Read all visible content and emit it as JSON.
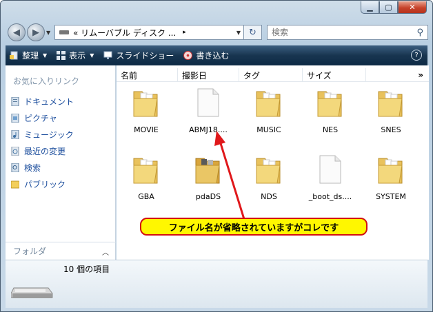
{
  "window": {
    "caption_buttons": [
      "minimize",
      "maximize",
      "close"
    ]
  },
  "address_bar": {
    "path_text": "« リムーバブル ディスク ...",
    "path_arrow": "▸"
  },
  "search": {
    "placeholder": "検索"
  },
  "toolbar": {
    "organize": "整理",
    "views": "表示",
    "slideshow": "スライドショー",
    "burn": "書き込む"
  },
  "favorites": {
    "title": "お気に入りリンク",
    "items": [
      {
        "label": "ドキュメント",
        "icon": "documents-icon"
      },
      {
        "label": "ピクチャ",
        "icon": "pictures-icon"
      },
      {
        "label": "ミュージック",
        "icon": "music-icon"
      },
      {
        "label": "最近の変更",
        "icon": "recent-icon"
      },
      {
        "label": "検索",
        "icon": "search-folder-icon"
      },
      {
        "label": "パブリック",
        "icon": "public-folder-icon"
      }
    ],
    "folders_label": "フォルダ"
  },
  "columns": [
    "名前",
    "撮影日",
    "タグ",
    "サイズ"
  ],
  "files": [
    {
      "name": "MOVIE",
      "type": "folder"
    },
    {
      "name": "ABMJ18....",
      "type": "file"
    },
    {
      "name": "MUSIC",
      "type": "folder"
    },
    {
      "name": "NES",
      "type": "folder"
    },
    {
      "name": "SNES",
      "type": "folder"
    },
    {
      "name": "GBA",
      "type": "folder"
    },
    {
      "name": "pdaDS",
      "type": "folder"
    },
    {
      "name": "NDS",
      "type": "folder"
    },
    {
      "name": "_boot_ds....",
      "type": "file"
    },
    {
      "name": "SYSTEM",
      "type": "folder"
    }
  ],
  "annotation": "ファイル名が省略されていますがコレです",
  "status": {
    "count_text": "10 個の項目"
  },
  "colors": {
    "annotation_bg": "#fff700",
    "annotation_border": "#d21010",
    "arrow": "#e0181b",
    "toolbar": "#183550"
  }
}
